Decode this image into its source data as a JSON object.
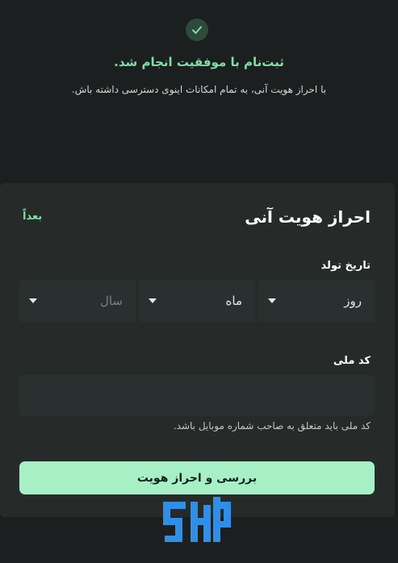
{
  "success": {
    "icon": "check-icon",
    "title": "ثبت‌نام با موفقیت انجام شد.",
    "subtitle": "با احراز هویت آنی، به تمام امکانات اینوی دسترسی داشته باش."
  },
  "sheet": {
    "title": "احراز هویت آنی",
    "later_label": "بعداً",
    "dob": {
      "label": "تاریخ تولد",
      "day_value": "روز",
      "month_value": "ماه",
      "year_placeholder": "سال"
    },
    "national_code": {
      "label": "کد ملی",
      "value": "",
      "hint": "کد ملی باید متعلق به صاحب شماره موبایل باشد."
    },
    "submit_label": "بررسی و احراز هویت"
  },
  "colors": {
    "accent": "#7fe0a4",
    "button_bg": "#a7f0c6",
    "background": "#1c1f1f",
    "sheet_bg": "#262b2a"
  },
  "watermark_icon": "watermark-logo-icon"
}
